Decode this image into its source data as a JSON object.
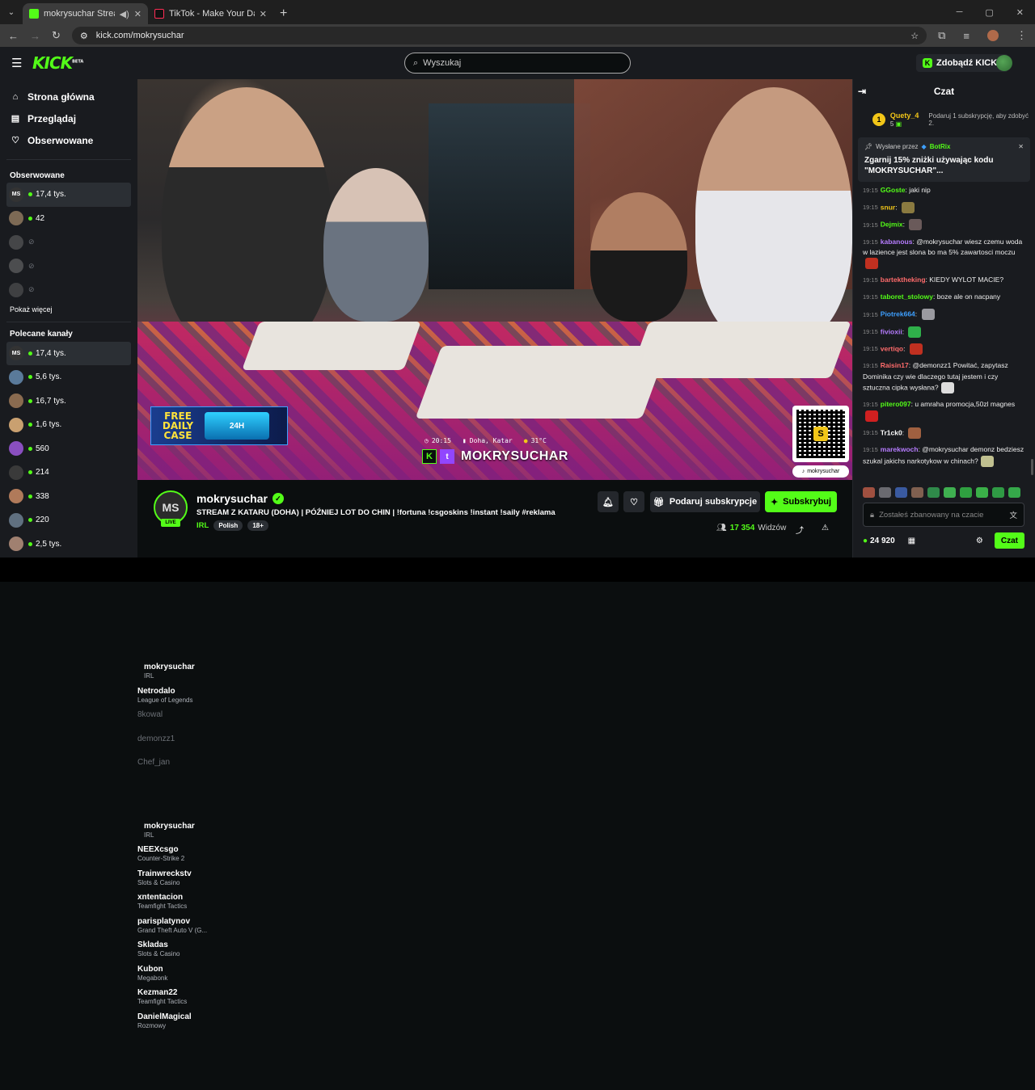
{
  "browser": {
    "tabs": [
      {
        "title": "mokrysuchar Stream - Watch...",
        "icon": "kick-favicon",
        "active": true
      },
      {
        "title": "TikTok - Make Your Day",
        "icon": "tiktok-favicon",
        "active": false
      }
    ],
    "url": "kick.com/mokrysuchar"
  },
  "header": {
    "logo": "KICK",
    "logo_badge": "BETA",
    "search_placeholder": "Wyszukaj",
    "get_kicks": "Zdobądź KICKs"
  },
  "sidebar": {
    "nav": [
      {
        "label": "Strona główna",
        "icon": "home-icon"
      },
      {
        "label": "Przeglądaj",
        "icon": "browse-icon"
      },
      {
        "label": "Obserwowane",
        "icon": "heart-icon"
      }
    ],
    "followed_title": "Obserwowane",
    "followed": [
      {
        "name": "mokrysuchar",
        "category": "IRL",
        "viewers": "17,4 tys.",
        "live": true,
        "avatar_text": "MS",
        "color": "#333"
      },
      {
        "name": "Netrodalo",
        "category": "League of Legends",
        "viewers": "42",
        "live": true,
        "avatar_text": "",
        "color": "#7d6a55"
      },
      {
        "name": "8kowal",
        "category": "",
        "viewers": "",
        "live": false,
        "avatar_text": "",
        "color": "#888"
      },
      {
        "name": "demonzz1",
        "category": "",
        "viewers": "",
        "live": false,
        "avatar_text": "",
        "color": "#999"
      },
      {
        "name": "Chef_jan",
        "category": "",
        "viewers": "",
        "live": false,
        "avatar_text": "",
        "color": "#777"
      }
    ],
    "show_more": "Pokaż więcej",
    "recommended_title": "Polecane kanały",
    "recommended": [
      {
        "name": "mokrysuchar",
        "category": "IRL",
        "viewers": "17,4 tys.",
        "avatar_text": "MS",
        "color": "#333"
      },
      {
        "name": "NEEXcsgo",
        "category": "Counter-Strike 2",
        "viewers": "5,6 tys.",
        "avatar_text": "",
        "color": "#5a7a9a"
      },
      {
        "name": "Trainwreckstv",
        "category": "Slots & Casino",
        "viewers": "16,7 tys.",
        "avatar_text": "",
        "color": "#8a6b50"
      },
      {
        "name": "xntentacion",
        "category": "Teamfight Tactics",
        "viewers": "1,6 tys.",
        "avatar_text": "",
        "color": "#c9a070"
      },
      {
        "name": "parisplatynov",
        "category": "Grand Theft Auto V (G...",
        "viewers": "560",
        "avatar_text": "",
        "color": "#8a4fc0"
      },
      {
        "name": "Skladas",
        "category": "Slots & Casino",
        "viewers": "214",
        "avatar_text": "",
        "color": "#3a3a3a"
      },
      {
        "name": "Kubon",
        "category": "Megabonk",
        "viewers": "338",
        "avatar_text": "",
        "color": "#b07a5a"
      },
      {
        "name": "Kezman22",
        "category": "Teamfight Tactics",
        "viewers": "220",
        "avatar_text": "",
        "color": "#607080"
      },
      {
        "name": "DanielMagical",
        "category": "Rozmowy",
        "viewers": "2,5 tys.",
        "avatar_text": "",
        "color": "#a08070"
      }
    ]
  },
  "video": {
    "time": "20:15",
    "location": "Doha, Katar",
    "temp": "31°C",
    "overlay_name": "MOKRYSUCHAR",
    "ad_text": "FREE DAILY CASE",
    "ad_box": "24H",
    "qr_handle": "mokrysuchar",
    "qr_letter": "S"
  },
  "stream": {
    "avatar": "MS",
    "live": "LIVE",
    "name": "mokrysuchar",
    "title": "STREAM Z KATARU (DOHA) | PÓŹNIEJ LOT DO CHIN | !fortuna !csgoskins !instant !saily #reklama",
    "category": "IRL",
    "tags": [
      "Polish",
      "18+"
    ],
    "gift_label": "Podaruj subskrypcje",
    "subscribe_label": "Subskrybuj",
    "viewers": "17 354",
    "viewers_label": "Widzów"
  },
  "chat": {
    "title": "Czat",
    "leader": {
      "rank": "1",
      "name": "Quety_4",
      "score": "5",
      "hint": "Podaruj 1 subskrypcję, aby zdobyć 2."
    },
    "pinned": {
      "by_label": "Wysłane przez",
      "by": "BotRix",
      "message": "Zgarnij 15% zniżki używając kodu \"MOKRYSUCHAR\"..."
    },
    "messages": [
      {
        "time": "19:15",
        "user": "GGoste",
        "color": "#53fc18",
        "text": "jaki nip",
        "emote": ""
      },
      {
        "time": "19:15",
        "user": "snur",
        "color": "#f2c618",
        "text": "",
        "emote": "#8a7a40"
      },
      {
        "time": "19:15",
        "user": "Dejmix",
        "color": "#53fc18",
        "text": "",
        "emote": "#6a5a5a"
      },
      {
        "time": "19:15",
        "user": "kabanous",
        "color": "#b67cff",
        "text": "@mokrysuchar wiesz czemu woda w lazience jest slona bo ma 5% zawartosci moczu",
        "emote": "#c03020"
      },
      {
        "time": "19:15",
        "user": "bartektheking",
        "color": "#ff6b6b",
        "text": "KIEDY WYLOT MACIE?",
        "emote": ""
      },
      {
        "time": "19:15",
        "user": "taboret_stolowy",
        "color": "#53fc18",
        "text": "boze ale on nacpany",
        "emote": ""
      },
      {
        "time": "19:15",
        "user": "Piotrek664",
        "color": "#3ea0ff",
        "text": "",
        "emote": "#9a9aa0"
      },
      {
        "time": "19:15",
        "user": "fivioxii",
        "color": "#b67cff",
        "text": "",
        "emote": "#2fb04a"
      },
      {
        "time": "19:15",
        "user": "vertiqo",
        "color": "#ff6b6b",
        "text": "",
        "emote": "#c03020"
      },
      {
        "time": "19:15",
        "user": "Raisin17",
        "color": "#ff6b6b",
        "text": "@demonzz1 Powitać, zapytasz Dominika czy wie dlaczego tutaj jestem i czy sztuczna cipka wysłana?",
        "emote": "#ddd"
      },
      {
        "time": "19:15",
        "user": "pitero097",
        "color": "#53fc18",
        "text": "u amraha promocja,50zl magnes",
        "emote": "#d02020"
      },
      {
        "time": "19:15",
        "user": "Tr1ck0",
        "color": "#fff",
        "text": "",
        "emote": "#a06040"
      },
      {
        "time": "19:15",
        "user": "marekwoch",
        "color": "#b67cff",
        "text": "@mokrysuchar demonz bedziesz szukal jakichs narkotykow w chinach?",
        "emote": "#c0c090"
      }
    ],
    "input_placeholder": "Zostałeś zbanowany na czacie",
    "points": "24 920",
    "send_label": "Czat"
  }
}
